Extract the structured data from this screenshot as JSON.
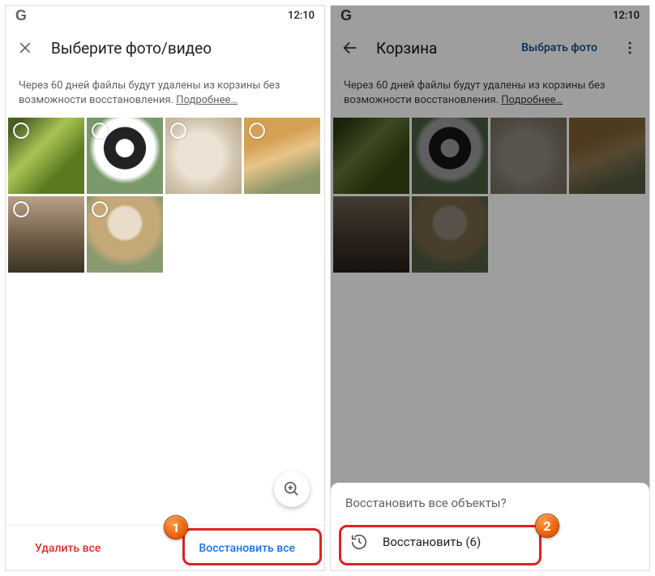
{
  "status": {
    "time": "12:10"
  },
  "left": {
    "title": "Выберите фото/видео",
    "info_text": "Через 60 дней файлы будут удалены из корзины без возможности восстановления. ",
    "info_more": "Подробнее…",
    "delete_all": "Удалить все",
    "restore_all": "Восстановить все"
  },
  "right": {
    "title": "Корзина",
    "select_photo": "Выбрать фото",
    "info_text": "Через 60 дней файлы будут удалены из корзины без возможности восстановления. ",
    "info_more": "Подробнее…",
    "sheet_title": "Восстановить все объекты?",
    "restore_count": "Восстановить (6)"
  },
  "callouts": {
    "one": "1",
    "two": "2"
  }
}
